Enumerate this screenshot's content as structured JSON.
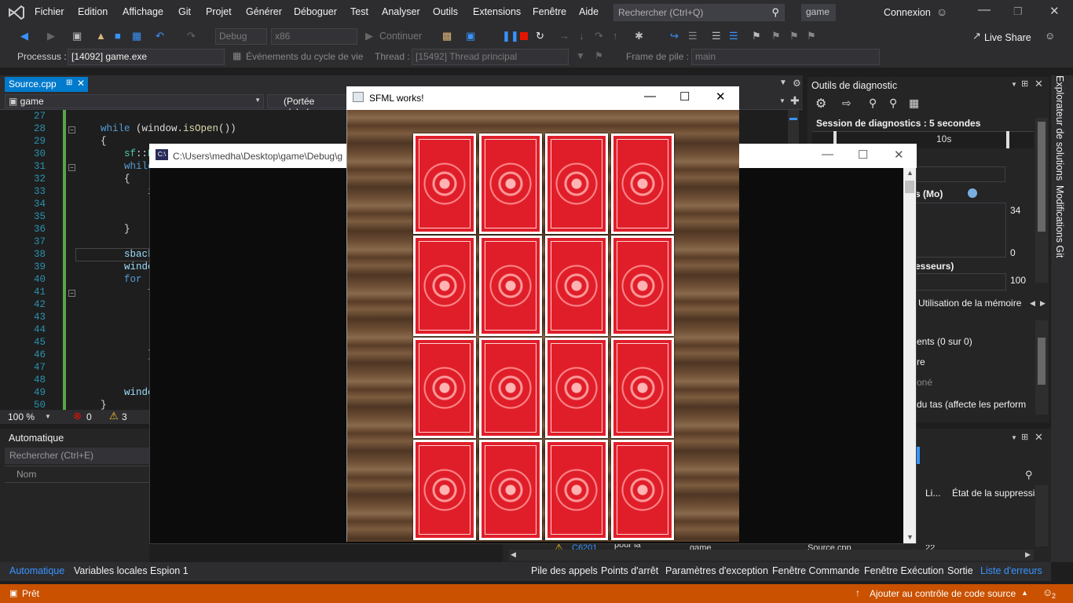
{
  "menu": {
    "items": [
      "Fichier",
      "Edition",
      "Affichage",
      "Git",
      "Projet",
      "Générer",
      "Déboguer",
      "Test",
      "Analyser",
      "Outils",
      "Extensions",
      "Fenêtre",
      "Aide"
    ],
    "search_placeholder": "Rechercher (Ctrl+Q)",
    "solution_name": "game",
    "connexion": "Connexion",
    "live_share": "Live Share"
  },
  "toolbar": {
    "config": "Debug",
    "platform": "x86",
    "continue": "Continuer"
  },
  "toolbar2": {
    "process_label": "Processus :",
    "process_value": "[14092] game.exe",
    "lifecycle_label": "Événements du cycle de vie",
    "thread_label": "Thread :",
    "thread_value": "[15492] Thread principal",
    "stack_label": "Frame de pile :",
    "stack_value": "main"
  },
  "editor": {
    "tab_name": "Source.cpp",
    "nav_project": "game",
    "nav_scope": "(Portée globale",
    "lines": [
      {
        "n": "27",
        "code": ""
      },
      {
        "n": "28",
        "code": "    while (window.isOpen())"
      },
      {
        "n": "29",
        "code": "    {"
      },
      {
        "n": "30",
        "code": "        sf::E"
      },
      {
        "n": "31",
        "code": "        while"
      },
      {
        "n": "32",
        "code": "        {"
      },
      {
        "n": "33",
        "code": "            i"
      },
      {
        "n": "34",
        "code": ""
      },
      {
        "n": "35",
        "code": ""
      },
      {
        "n": "36",
        "code": "        }"
      },
      {
        "n": "37",
        "code": ""
      },
      {
        "n": "38",
        "code": "        sback"
      },
      {
        "n": "39",
        "code": "        windo"
      },
      {
        "n": "40",
        "code": "        for ("
      },
      {
        "n": "41",
        "code": "            f"
      },
      {
        "n": "42",
        "code": ""
      },
      {
        "n": "43",
        "code": ""
      },
      {
        "n": "44",
        "code": ""
      },
      {
        "n": "45",
        "code": ""
      },
      {
        "n": "46",
        "code": "            }"
      },
      {
        "n": "47",
        "code": ""
      },
      {
        "n": "48",
        "code": ""
      },
      {
        "n": "49",
        "code": "        windo"
      },
      {
        "n": "50",
        "code": "    }"
      }
    ],
    "zoom": "100 %",
    "errors": "0",
    "warnings": "3"
  },
  "auto_panel": {
    "title": "Automatique",
    "search": "Rechercher (Ctrl+E)",
    "col_name": "Nom"
  },
  "bottom_left_tabs": [
    "Automatique",
    "Variables locales",
    "Espion 1"
  ],
  "bottom_right_tabs": [
    "Pile des appels",
    "Points d'arrêt",
    "Paramètres d'exception",
    "Fenêtre Commande",
    "Fenêtre Exécution",
    "Sortie",
    "Liste d'erreurs"
  ],
  "diagnostics": {
    "title": "Outils de diagnostic",
    "session": "Session de diagnostics : 5 secondes",
    "time_tick": "10s",
    "memory_label": "s (Mo)",
    "mem_max": "34",
    "mem_min": "0",
    "cpu_label": "esseurs)",
    "cpu_max": "100",
    "mem_usage_tab": "Utilisation de la mémoire",
    "events": "ents (0 sur 0)",
    "re": "re",
    "one": "oné",
    "heap": "du tas (affecte les perform"
  },
  "error_list": {
    "col_li": "Li...",
    "col_state": "État de la suppressi...",
    "code": "C6201",
    "desc": "pour la",
    "proj": "game",
    "file": "Source.cpp",
    "line": "22"
  },
  "side_tabs": [
    "Explorateur de solutions",
    "Modifications Git"
  ],
  "console": {
    "title": "C:\\Users\\medha\\Desktop\\game\\Debug\\g"
  },
  "sfml": {
    "title": "SFML works!",
    "card_rows": 4,
    "card_cols": 4
  },
  "status": {
    "ready": "Prêt",
    "source_control": "Ajouter au contrôle de code source",
    "notifications": "2"
  }
}
